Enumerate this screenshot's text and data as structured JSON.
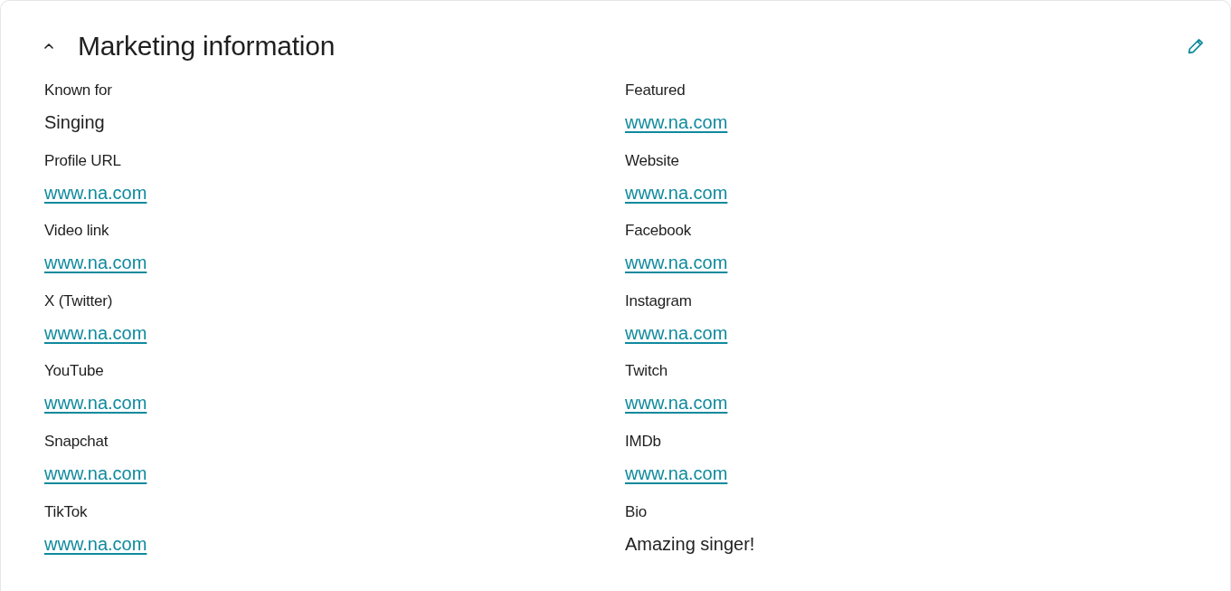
{
  "section": {
    "title": "Marketing information",
    "expanded": true,
    "fields": [
      {
        "label": "Known for",
        "value": "Singing",
        "kind": "text"
      },
      {
        "label": "Featured",
        "value": "www.na.com",
        "kind": "link"
      },
      {
        "label": "Profile URL",
        "value": "www.na.com",
        "kind": "link"
      },
      {
        "label": "Website",
        "value": "www.na.com",
        "kind": "link"
      },
      {
        "label": "Video link",
        "value": "www.na.com",
        "kind": "link"
      },
      {
        "label": "Facebook",
        "value": "www.na.com",
        "kind": "link"
      },
      {
        "label": "X (Twitter)",
        "value": "www.na.com",
        "kind": "link"
      },
      {
        "label": "Instagram",
        "value": "www.na.com",
        "kind": "link"
      },
      {
        "label": "YouTube",
        "value": "www.na.com",
        "kind": "link"
      },
      {
        "label": "Twitch",
        "value": "www.na.com",
        "kind": "link"
      },
      {
        "label": "Snapchat",
        "value": "www.na.com",
        "kind": "link"
      },
      {
        "label": "IMDb",
        "value": "www.na.com",
        "kind": "link"
      },
      {
        "label": "TikTok",
        "value": "www.na.com",
        "kind": "link"
      },
      {
        "label": "Bio",
        "value": "Amazing singer!",
        "kind": "text"
      }
    ]
  }
}
